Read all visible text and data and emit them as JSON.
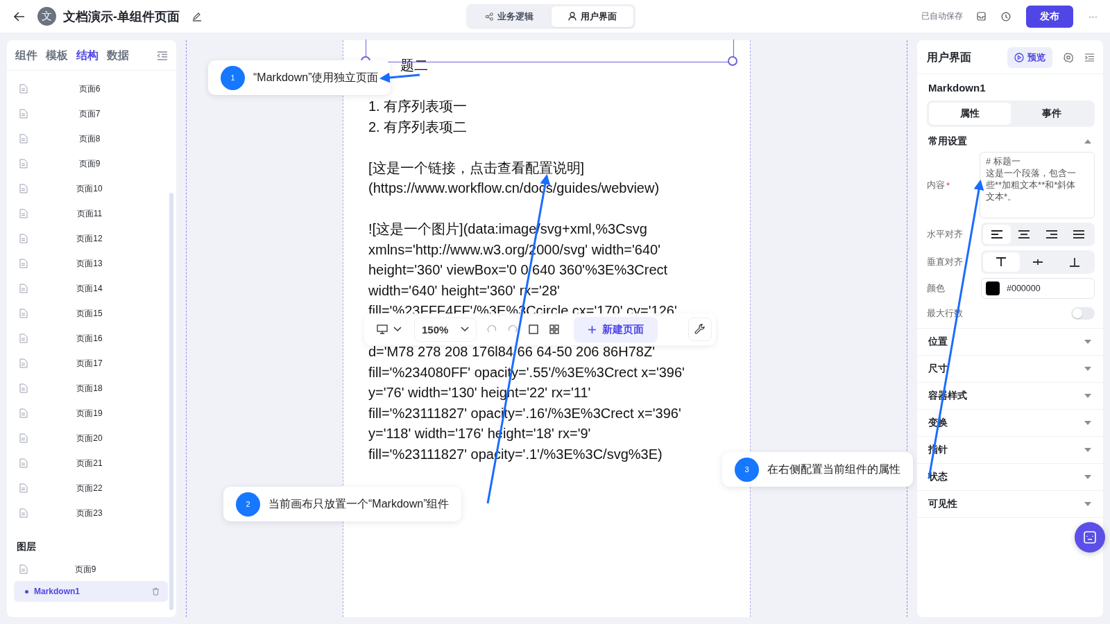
{
  "header": {
    "avatar": "文",
    "title": "文档演示-单组件页面",
    "modes": [
      {
        "label": "业务逻辑",
        "selected": false
      },
      {
        "label": "用户界面",
        "selected": true
      }
    ],
    "autosave": "已自动保存",
    "publish": "发布",
    "more": "···"
  },
  "left_panel": {
    "tabs": [
      {
        "label": "组件",
        "selected": false
      },
      {
        "label": "模板",
        "selected": false
      },
      {
        "label": "结构",
        "selected": true
      },
      {
        "label": "数据",
        "selected": false
      }
    ],
    "pages": [
      "页面6",
      "页面7",
      "页面8",
      "页面9",
      "页面10",
      "页面11",
      "页面12",
      "页面13",
      "页面14",
      "页面15",
      "页面16",
      "页面17",
      "页面18",
      "页面19",
      "页面20",
      "页面21",
      "页面22",
      "页面23"
    ],
    "layers_title": "图层",
    "layers": [
      {
        "label": "页面9",
        "kind": "page",
        "selected": false
      },
      {
        "label": "Markdown1",
        "kind": "component",
        "selected": true
      }
    ]
  },
  "canvas": {
    "blocks": [
      [
        "题二"
      ],
      [
        "1. 有序列表项一",
        "2. 有序列表项二"
      ],
      [
        "[这是一个链接，点击查看配置说明]",
        "(https://www.workflow.cn/docs/guides/webview)"
      ],
      [
        "![这是一个图片](data:image/svg+xml,%3Csvg",
        "xmlns='http://www.w3.org/2000/svg' width='640'",
        "height='360' viewBox='0 0 640 360'%3E%3Crect",
        "width='640' height='360' rx='28'",
        "fill='%23FFF4FF'/%3E%3Ccircle cx='170' cy='126'"
      ],
      [
        "d='M78 278 208 176l84 66 64-50 206 86H78Z'",
        "fill='%234080FF' opacity='.55'/%3E%3Crect x='396'",
        "y='76' width='130' height='22' rx='11'",
        "fill='%23111827' opacity='.16'/%3E%3Crect x='396'",
        "y='118' width='176' height='18' rx='9'",
        "fill='%23111827' opacity='.1'/%3E%3C/svg%3E)"
      ]
    ],
    "toolbar": {
      "zoom": "150%",
      "new_page": "新建页面"
    }
  },
  "callouts": [
    {
      "number": "1",
      "text": "“Markdown”使用独立页面"
    },
    {
      "number": "2",
      "text": "当前画布只放置一个“Markdown”组件"
    },
    {
      "number": "3",
      "text": "在右侧配置当前组件的属性"
    }
  ],
  "right_panel": {
    "title": "用户界面",
    "preview": "预览",
    "component": "Markdown1",
    "tabs": [
      {
        "label": "属性",
        "selected": true
      },
      {
        "label": "事件",
        "selected": false
      }
    ],
    "section": {
      "title": "常用设置",
      "expanded": true
    },
    "content": {
      "label": "内容",
      "required_mark": "*",
      "lines": [
        "# 标题一",
        "这是一个段落，包含一些**加粗文本**和*斜体文本*。"
      ]
    },
    "h_align": {
      "label": "水平对齐",
      "options": [
        {
          "kind": "left",
          "selected": true
        },
        {
          "kind": "center",
          "selected": false
        },
        {
          "kind": "right",
          "selected": false
        },
        {
          "kind": "justify",
          "selected": false
        }
      ]
    },
    "v_align": {
      "label": "垂直对齐",
      "options": [
        {
          "kind": "top",
          "selected": true
        },
        {
          "kind": "middle",
          "selected": false
        },
        {
          "kind": "bottom",
          "selected": false
        }
      ]
    },
    "color": {
      "label": "颜色",
      "value": "#000000",
      "color": "#000000"
    },
    "max_lines": {
      "label": "最大行数",
      "on": false
    },
    "sections": [
      {
        "title": "位置",
        "expanded": false
      },
      {
        "title": "尺寸",
        "expanded": false
      },
      {
        "title": "容器样式",
        "expanded": false
      },
      {
        "title": "变换",
        "expanded": false
      },
      {
        "title": "指针",
        "expanded": false
      },
      {
        "title": "状态",
        "expanded": false
      },
      {
        "title": "可见性",
        "expanded": false
      }
    ]
  }
}
